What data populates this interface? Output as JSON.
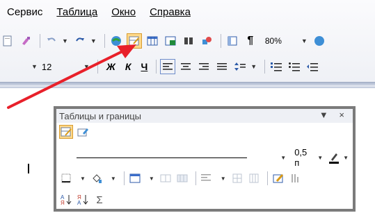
{
  "menu": {
    "items": [
      {
        "label": "Сервис",
        "accel": ""
      },
      {
        "label": "Таблица",
        "accel": "Т"
      },
      {
        "label": "Окно",
        "accel": "О"
      },
      {
        "label": "Справка",
        "accel": "С"
      }
    ]
  },
  "toolbar": {
    "zoom": "80%",
    "font_size": "12",
    "bold_label": "Ж",
    "italic_label": "К",
    "underline_label": "Ч",
    "paragraph_label": "¶"
  },
  "panel": {
    "title": "Таблицы и границы",
    "line_width": "0,5 п",
    "controls": "▼ ×"
  },
  "colors": {
    "arrow": "#e8202a",
    "highlight": "#ffd98a",
    "panel_border": "#7b7b7b"
  },
  "icons": [
    "table-borders-icon",
    "draw-table-icon",
    "eraser-icon",
    "sort-ascending-icon",
    "sort-descending-icon",
    "autosum-icon"
  ]
}
